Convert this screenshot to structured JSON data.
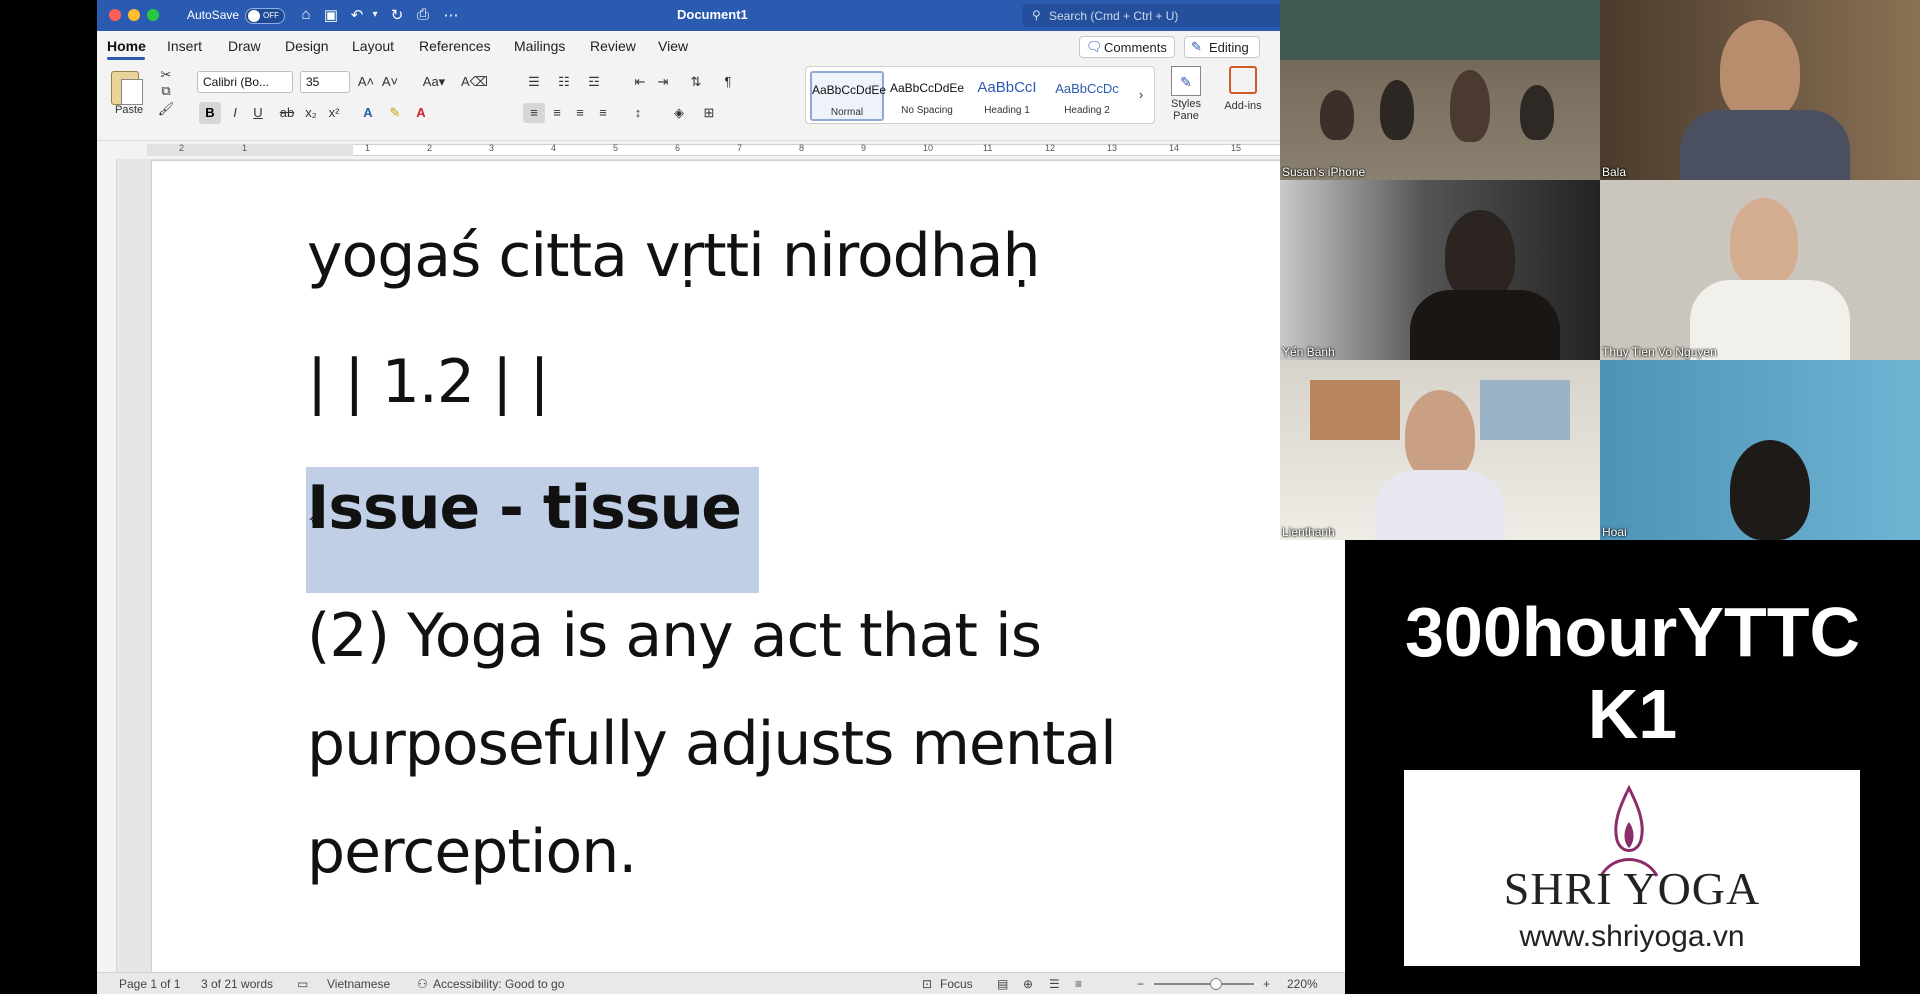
{
  "word": {
    "titlebar": {
      "autosave_label": "AutoSave",
      "autosave_state": "OFF",
      "document_title": "Document1",
      "search_placeholder": "Search (Cmd + Ctrl + U)"
    },
    "tabs": [
      "Home",
      "Insert",
      "Draw",
      "Design",
      "Layout",
      "References",
      "Mailings",
      "Review",
      "View"
    ],
    "comments_label": "Comments",
    "editing_label": "Editing",
    "ribbon": {
      "paste_label": "Paste",
      "font_name": "Calibri (Bo...",
      "font_size": "35",
      "styles": [
        {
          "preview": "AaBbCcDdEe",
          "name": "Normal"
        },
        {
          "preview": "AaBbCcDdEe",
          "name": "No Spacing"
        },
        {
          "preview": "AaBbCcI",
          "name": "Heading 1"
        },
        {
          "preview": "AaBbCcDc",
          "name": "Heading 2"
        }
      ],
      "styles_pane_label": "Styles Pane",
      "addins_label": "Add-ins"
    },
    "ruler_numbers": [
      "2",
      "1",
      "1",
      "2",
      "3",
      "4",
      "5",
      "6",
      "7",
      "8",
      "9",
      "10",
      "11",
      "12",
      "13",
      "14",
      "15"
    ],
    "document_lines": [
      "yogaś citta vṛtti nirodhaḥ",
      "| | 1.2 | |",
      "Issue - tissue",
      "(2) Yoga is any act that is",
      "purposefully adjusts mental",
      "perception."
    ],
    "status": {
      "page": "Page 1 of 1",
      "words": "3 of 21 words",
      "language": "Vietnamese",
      "accessibility": "Accessibility: Good to go",
      "focus": "Focus",
      "zoom": "220%"
    }
  },
  "participants": [
    "Susan’s iPhone",
    "Bala",
    "Yến Bành",
    "Thuy Tien Vo Nguyen",
    "Lienthanh",
    "Hoai"
  ],
  "promo": {
    "line1": "300hourYTTC",
    "line2": "K1",
    "brand": "SHRI YOGA",
    "url": "www.shriyoga.vn"
  },
  "colors": {
    "titlebar": "#2b5bb0",
    "highlight": "#c0cfe6",
    "logo_accent": "#8a2d68"
  }
}
